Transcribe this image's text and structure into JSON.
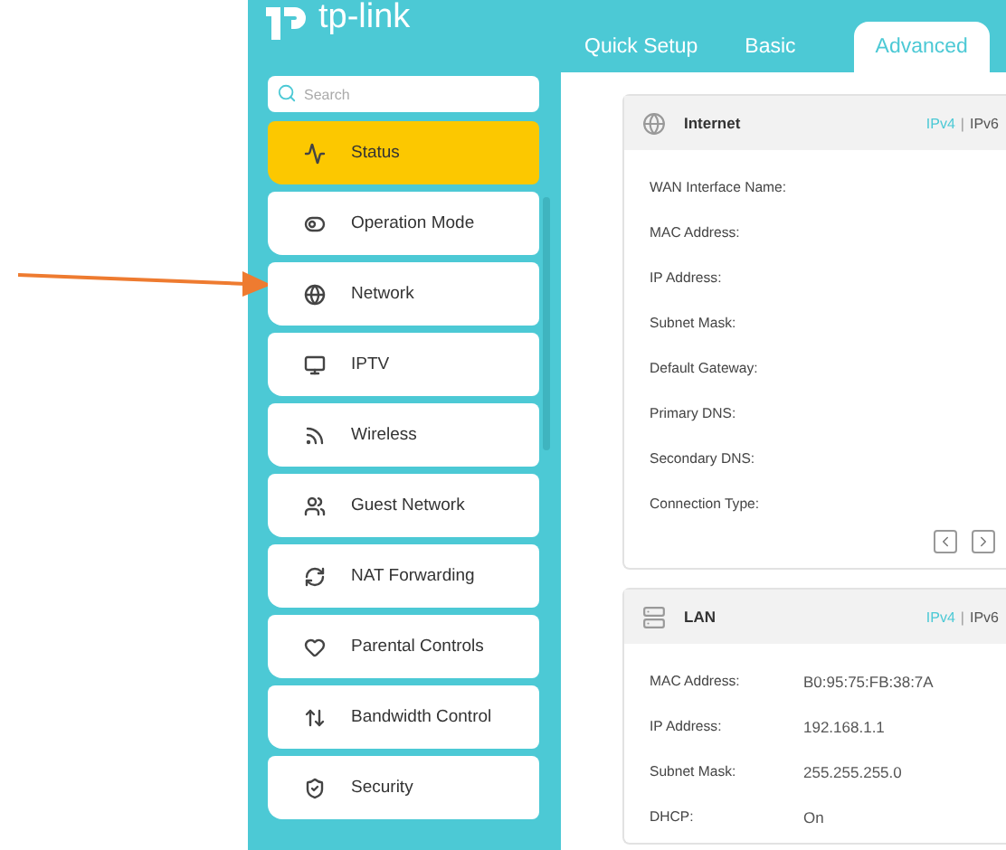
{
  "logo": "tp-link",
  "tabs": [
    {
      "label": "Quick Setup",
      "selected": false
    },
    {
      "label": "Basic",
      "selected": false
    },
    {
      "label": "Advanced",
      "selected": true
    }
  ],
  "search": {
    "placeholder": "Search"
  },
  "sidebar": {
    "items": [
      {
        "label": "Status",
        "selected": true
      },
      {
        "label": "Operation Mode",
        "selected": false
      },
      {
        "label": "Network",
        "selected": false
      },
      {
        "label": "IPTV",
        "selected": false
      },
      {
        "label": "Wireless",
        "selected": false
      },
      {
        "label": "Guest Network",
        "selected": false
      },
      {
        "label": "NAT Forwarding",
        "selected": false
      },
      {
        "label": "Parental Controls",
        "selected": false
      },
      {
        "label": "Bandwidth Control",
        "selected": false
      },
      {
        "label": "Security",
        "selected": false
      }
    ]
  },
  "cards": [
    {
      "title": "Internet",
      "separator": "|",
      "versions": [
        {
          "label": "IPv4",
          "selected": true
        },
        {
          "label": "IPv6",
          "selected": false
        }
      ],
      "pager": true,
      "rows": [
        {
          "label": "WAN Interface Name:"
        },
        {
          "label": "MAC Address:"
        },
        {
          "label": "IP Address:"
        },
        {
          "label": "Subnet Mask:"
        },
        {
          "label": "Default Gateway:"
        },
        {
          "label": "Primary DNS:"
        },
        {
          "label": "Secondary DNS:"
        },
        {
          "label": "Connection Type:"
        }
      ]
    },
    {
      "title": "LAN",
      "separator": "|",
      "versions": [
        {
          "label": "IPv4",
          "selected": true
        },
        {
          "label": "IPv6",
          "selected": false
        }
      ],
      "pager": false,
      "rows": [
        {
          "label": "MAC Address:",
          "value": "B0:95:75:FB:38:7A"
        },
        {
          "label": "IP Address:",
          "value": "192.168.1.1"
        },
        {
          "label": "Subnet Mask:",
          "value": "255.255.255.0"
        },
        {
          "label": "DHCP:",
          "value": "On"
        }
      ]
    }
  ]
}
